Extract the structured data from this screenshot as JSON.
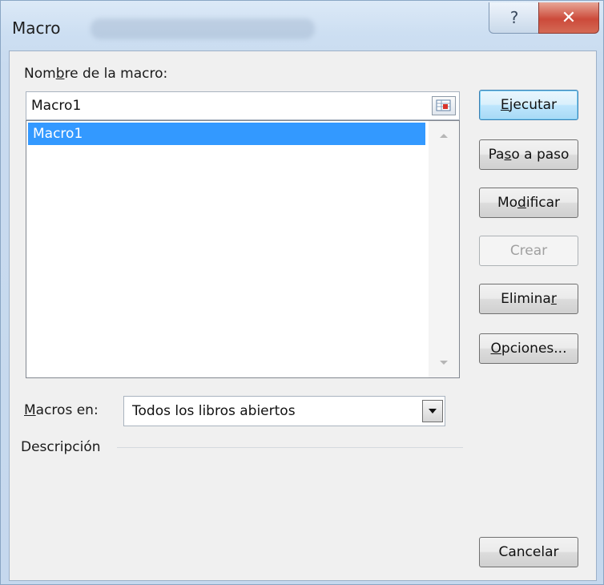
{
  "dialog": {
    "title": "Macro",
    "help_glyph": "?",
    "close_glyph": "✕"
  },
  "macro_name": {
    "label_pre": "Nom",
    "label_ul": "b",
    "label_post": "re de la macro:",
    "value": "Macro1"
  },
  "macro_list": {
    "items": [
      "Macro1"
    ],
    "selected": "Macro1"
  },
  "buttons": {
    "run": {
      "pre": "",
      "ul": "E",
      "post": "jecutar"
    },
    "step": {
      "pre": "Pa",
      "ul": "s",
      "post": "o a paso"
    },
    "edit": {
      "pre": "Mo",
      "ul": "d",
      "post": "ificar"
    },
    "create": {
      "pre": "",
      "ul": "",
      "post": "Crear"
    },
    "delete": {
      "pre": "Elimina",
      "ul": "r",
      "post": ""
    },
    "options": {
      "pre": "",
      "ul": "O",
      "post": "pciones..."
    },
    "cancel": {
      "pre": "",
      "ul": "",
      "post": "Cancelar"
    }
  },
  "macros_en": {
    "label_pre": "",
    "label_ul": "M",
    "label_post": "acros en:",
    "value": "Todos los libros abiertos"
  },
  "description": {
    "label": "Descripción"
  },
  "icons": {
    "help": "help-icon",
    "close": "close-icon",
    "reference": "collapse-dialog-icon",
    "dropdown": "chevron-down-icon"
  }
}
